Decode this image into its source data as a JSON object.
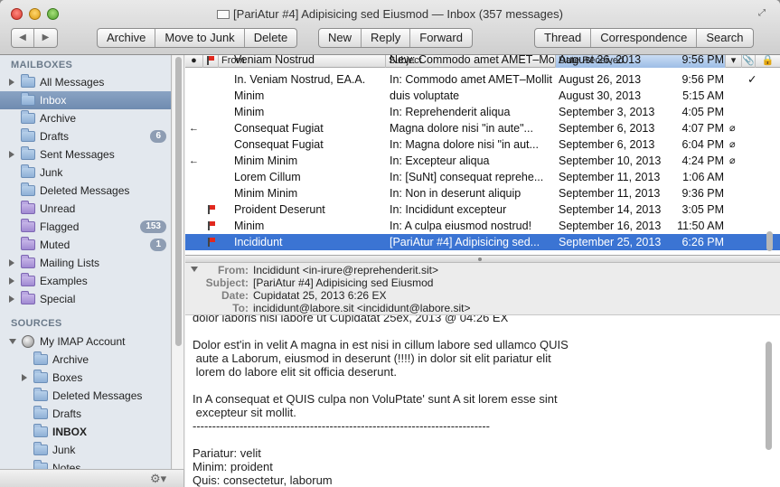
{
  "window": {
    "title": "[PariAtur #4] Adipisicing sed Eiusmod — Inbox (357 messages)"
  },
  "toolbar": {
    "back": "◀",
    "forward": "▶",
    "archive": "Archive",
    "move_to_junk": "Move to Junk",
    "delete": "Delete",
    "new": "New",
    "reply": "Reply",
    "forward_msg": "Forward",
    "thread": "Thread",
    "correspondence": "Correspondence",
    "search": "Search"
  },
  "sidebar": {
    "mailboxes_header": "MAILBOXES",
    "items": [
      {
        "label": "All Messages"
      },
      {
        "label": "Inbox"
      },
      {
        "label": "Archive"
      },
      {
        "label": "Drafts",
        "badge": "6"
      },
      {
        "label": "Sent Messages"
      },
      {
        "label": "Junk"
      },
      {
        "label": "Deleted Messages"
      },
      {
        "label": "Unread"
      },
      {
        "label": "Flagged",
        "badge": "153"
      },
      {
        "label": "Muted",
        "badge": "1"
      },
      {
        "label": "Mailing Lists"
      },
      {
        "label": "Examples"
      },
      {
        "label": "Special"
      }
    ],
    "sources_header": "SOURCES",
    "account": "My IMAP Account",
    "account_items": [
      {
        "label": "Archive"
      },
      {
        "label": "Boxes"
      },
      {
        "label": "Deleted Messages"
      },
      {
        "label": "Drafts"
      },
      {
        "label": "INBOX"
      },
      {
        "label": "Junk"
      },
      {
        "label": "Notes"
      }
    ]
  },
  "columns": {
    "from": "From",
    "subject": "Subject",
    "date": "Date Received"
  },
  "messages": [
    {
      "from": "Veniam Nostrud",
      "subject": "New: Commodo amet AMET–Mollit",
      "date": "August 26, 2013",
      "time": "9:56 PM",
      "flagged": false,
      "replied": false,
      "attachment": false
    },
    {
      "from": "In. Veniam Nostrud, EA.A.",
      "subject": "In: Commodo amet AMET–Mollit",
      "date": "August 26, 2013",
      "time": "9:56 PM",
      "flagged": false,
      "replied": false,
      "attachment": false,
      "check": "✓"
    },
    {
      "from": "Minim",
      "subject": "duis voluptate",
      "date": "August 30, 2013",
      "time": "5:15 AM",
      "flagged": false,
      "replied": false,
      "attachment": false
    },
    {
      "from": "Minim",
      "subject": "In: Reprehenderit aliqua",
      "date": "September 3, 2013",
      "time": "4:05 PM",
      "flagged": false,
      "replied": false,
      "attachment": false
    },
    {
      "from": "Consequat Fugiat",
      "subject": "Magna dolore nisi \"in aute\"...",
      "date": "September 6, 2013",
      "time": "4:07 PM",
      "flagged": false,
      "replied": true,
      "attachment": true
    },
    {
      "from": "Consequat Fugiat",
      "subject": "In: Magna dolore nisi \"in aut...",
      "date": "September 6, 2013",
      "time": "6:04 PM",
      "flagged": false,
      "replied": false,
      "attachment": true
    },
    {
      "from": "Minim Minim",
      "subject": "In: Excepteur aliqua",
      "date": "September 10, 2013",
      "time": "4:24 PM",
      "flagged": false,
      "replied": true,
      "attachment": true
    },
    {
      "from": "Lorem Cillum",
      "subject": "In: [SuNt] consequat reprehe...",
      "date": "September 11, 2013",
      "time": "1:06 AM",
      "flagged": false,
      "replied": false,
      "attachment": false
    },
    {
      "from": "Minim Minim",
      "subject": "In: Non in deserunt aliquip",
      "date": "September 11, 2013",
      "time": "9:36 PM",
      "flagged": false,
      "replied": false,
      "attachment": false
    },
    {
      "from": "Proident Deserunt",
      "subject": "In: Incididunt excepteur",
      "date": "September 14, 2013",
      "time": "3:05 PM",
      "flagged": true,
      "replied": false,
      "attachment": false
    },
    {
      "from": "Minim",
      "subject": "In: A culpa eiusmod nostrud!",
      "date": "September 16, 2013",
      "time": "11:50 AM",
      "flagged": true,
      "replied": false,
      "attachment": false
    },
    {
      "from": "Incididunt",
      "subject": "[PariAtur #4] Adipisicing sed...",
      "date": "September 25, 2013",
      "time": "6:26 PM",
      "flagged": true,
      "replied": false,
      "attachment": false,
      "selected": true
    }
  ],
  "header": {
    "from_label": "From:",
    "from": "Incididunt <in-irure@reprehenderit.sit>",
    "subject_label": "Subject:",
    "subject": "[PariAtur #4] Adipisicing sed Eiusmod",
    "date_label": "Date:",
    "date": "Cupidatat 25, 2013 6:26 EX",
    "to_label": "To:",
    "to": "incididunt@labore.sit <incididunt@labore.sit>"
  },
  "body": {
    "text": "dolor laboris nisi labore ut Cupidatat 25ex, 2013 @ 04:26 EX\n\nDolor est'in in velit A magna in est nisi in cillum labore sed ullamco QUIS\n aute a Laborum, eiusmod in deserunt (!!!!) in dolor sit elit pariatur elit\n lorem do labore elit sit officia deserunt.\n\nIn A consequat et QUIS culpa non VoluPtate' sunt A sit lorem esse sint\n excepteur sit mollit.\n----------------------------------------------------------------------------\n\nPariatur: velit\nMinim: proident\nQuis: consectetur, laborum"
  },
  "colors": {
    "selection": "#3b74d3",
    "sidebar_selection": "#7a94b8",
    "flag": "#e0281e",
    "badge": "#8e9db3"
  }
}
